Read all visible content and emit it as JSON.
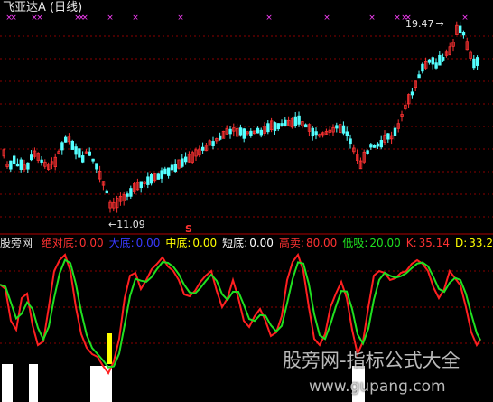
{
  "title": "飞亚达A (日线)",
  "colors": {
    "up": "#ff3232",
    "down": "#54ffff",
    "grid": "#8b0000",
    "mark": "#ff40ff",
    "k": "#ff2020",
    "d": "#20e020",
    "bar": "#ffffff",
    "yellow": "#ffff00"
  },
  "price": {
    "high_label": "19.47",
    "low_label": "11.09",
    "marker": "S",
    "top_x_markers": [
      "×",
      "×",
      "×",
      "×",
      "×",
      "×",
      "×",
      "×",
      "×",
      "×",
      "×",
      "×",
      "×",
      "×",
      "×",
      "×",
      "×"
    ]
  },
  "indicator": {
    "name": "股旁网",
    "items": [
      {
        "label": "绝对底:",
        "value": "0.00",
        "color": "#ff3232"
      },
      {
        "label": "大底:",
        "value": "0.00",
        "color": "#3a3aff"
      },
      {
        "label": "中底:",
        "value": "0.00",
        "color": "#ffff00"
      },
      {
        "label": "短底:",
        "value": "0.00",
        "color": "#ffffff"
      },
      {
        "label": "高卖:",
        "value": "80.00",
        "color": "#ff3232"
      },
      {
        "label": "低吸:",
        "value": "20.00",
        "color": "#20e020"
      },
      {
        "label": "K:",
        "value": "35.14",
        "color": "#ff3232"
      },
      {
        "label": "D:",
        "value": "33.2",
        "color": "#ffff00"
      }
    ]
  },
  "watermark": {
    "line1": "股旁网-指标公式大全",
    "line2": "www.gupang.com"
  }
}
